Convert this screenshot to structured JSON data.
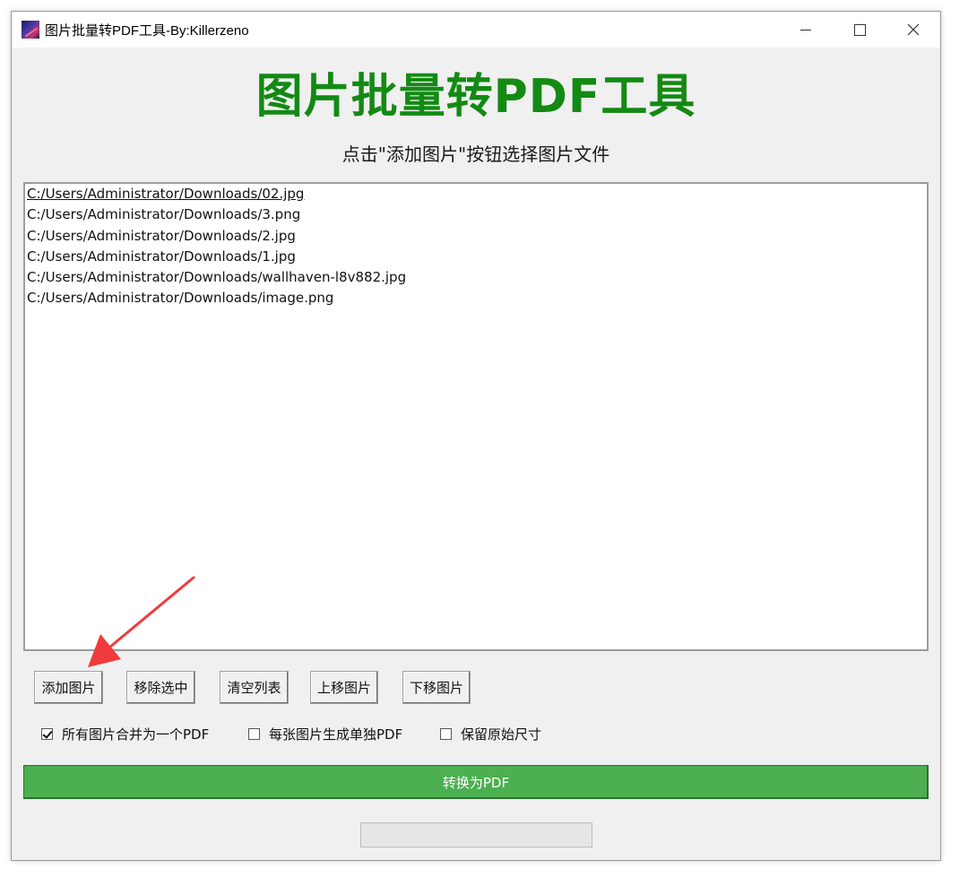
{
  "window": {
    "title": "图片批量转PDF工具-By:Killerzeno"
  },
  "header": {
    "title": "图片批量转PDF工具",
    "instruction": "点击\"添加图片\"按钮选择图片文件"
  },
  "file_list": {
    "items": [
      "C:/Users/Administrator/Downloads/02.jpg",
      "C:/Users/Administrator/Downloads/3.png",
      "C:/Users/Administrator/Downloads/2.jpg",
      "C:/Users/Administrator/Downloads/1.jpg",
      "C:/Users/Administrator/Downloads/wallhaven-l8v882.jpg",
      "C:/Users/Administrator/Downloads/image.png"
    ]
  },
  "toolbar": {
    "add_label": "添加图片",
    "remove_label": "移除选中",
    "clear_label": "清空列表",
    "up_label": "上移图片",
    "down_label": "下移图片"
  },
  "options": {
    "merge_label": "所有图片合并为一个PDF",
    "merge_checked": true,
    "separate_label": "每张图片生成单独PDF",
    "separate_checked": false,
    "keep_size_label": "保留原始尺寸",
    "keep_size_checked": false
  },
  "convert": {
    "label": "转换为PDF",
    "color": "#4caf50"
  },
  "progress": {
    "fraction": 0
  },
  "colors": {
    "title_green": "#138a13",
    "annotation_arrow": "#ef3b3b"
  }
}
